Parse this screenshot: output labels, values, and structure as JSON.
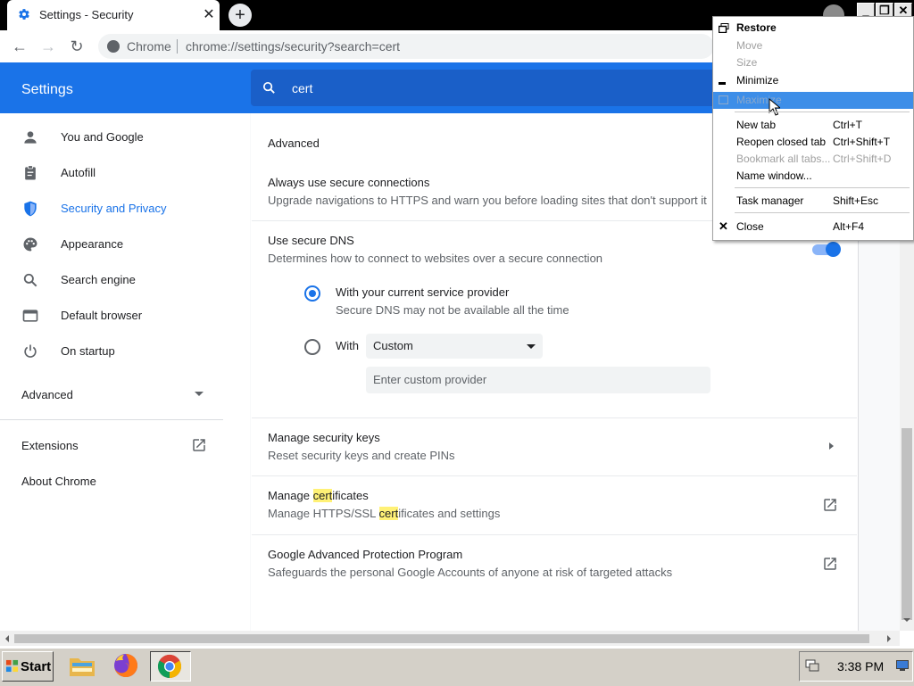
{
  "tab": {
    "title": "Settings - Security",
    "close": "✕",
    "new_tab": "+"
  },
  "toolbar": {
    "back": "←",
    "forward": "→",
    "reload": "↻",
    "site": "Chrome",
    "url": "chrome://settings/security?search=cert"
  },
  "window_buttons": {
    "minimize": "_",
    "restore": "❐",
    "close": "✕"
  },
  "settings": {
    "title": "Settings",
    "search_value": "cert",
    "sidebar": {
      "items": [
        {
          "label": "You and Google",
          "icon": "person-icon"
        },
        {
          "label": "Autofill",
          "icon": "clipboard-icon"
        },
        {
          "label": "Security and Privacy",
          "icon": "shield-icon"
        },
        {
          "label": "Appearance",
          "icon": "palette-icon"
        },
        {
          "label": "Search engine",
          "icon": "search-icon"
        },
        {
          "label": "Default browser",
          "icon": "browser-icon"
        },
        {
          "label": "On startup",
          "icon": "power-icon"
        }
      ],
      "advanced": "Advanced",
      "extensions": "Extensions",
      "about": "About Chrome"
    },
    "main": {
      "section": "Advanced",
      "secure_connections": {
        "title": "Always use secure connections",
        "sub": "Upgrade navigations to HTTPS and warn you before loading sites that don't support it"
      },
      "secure_dns": {
        "title": "Use secure DNS",
        "sub": "Determines how to connect to websites over a secure connection",
        "opt1_title": "With your current service provider",
        "opt1_sub": "Secure DNS may not be available all the time",
        "opt2_label": "With",
        "select_value": "Custom",
        "custom_placeholder": "Enter custom provider"
      },
      "security_keys": {
        "title": "Manage security keys",
        "sub": "Reset security keys and create PINs"
      },
      "certificates": {
        "title_pre": "Manage ",
        "title_hl": "cert",
        "title_post": "ificates",
        "sub_pre": "Manage HTTPS/SSL ",
        "sub_hl": "cert",
        "sub_post": "ificates and settings"
      },
      "advanced_protection": {
        "title": "Google Advanced Protection Program",
        "sub": "Safeguards the personal Google Accounts of anyone at risk of targeted attacks"
      }
    }
  },
  "context_menu": [
    {
      "label": "Restore",
      "shortcut": "",
      "state": "bold"
    },
    {
      "label": "Move",
      "shortcut": "",
      "state": "disabled"
    },
    {
      "label": "Size",
      "shortcut": "",
      "state": "disabled"
    },
    {
      "label": "Minimize",
      "shortcut": "",
      "state": "normal"
    },
    {
      "label": "Maximize",
      "shortcut": "",
      "state": "selected"
    },
    {
      "label": "New tab",
      "shortcut": "Ctrl+T",
      "state": "normal"
    },
    {
      "label": "Reopen closed tab",
      "shortcut": "Ctrl+Shift+T",
      "state": "normal"
    },
    {
      "label": "Bookmark all tabs...",
      "shortcut": "Ctrl+Shift+D",
      "state": "disabled"
    },
    {
      "label": "Name window...",
      "shortcut": "",
      "state": "normal"
    },
    {
      "label": "Task manager",
      "shortcut": "Shift+Esc",
      "state": "normal"
    },
    {
      "label": "Close",
      "shortcut": "Alt+F4",
      "state": "normal"
    }
  ],
  "taskbar": {
    "start": "Start",
    "clock": "3:38 PM"
  },
  "colors": {
    "accent": "#1a73e8",
    "highlight": "#fff176",
    "menu_selection": "#3d8ee8"
  }
}
